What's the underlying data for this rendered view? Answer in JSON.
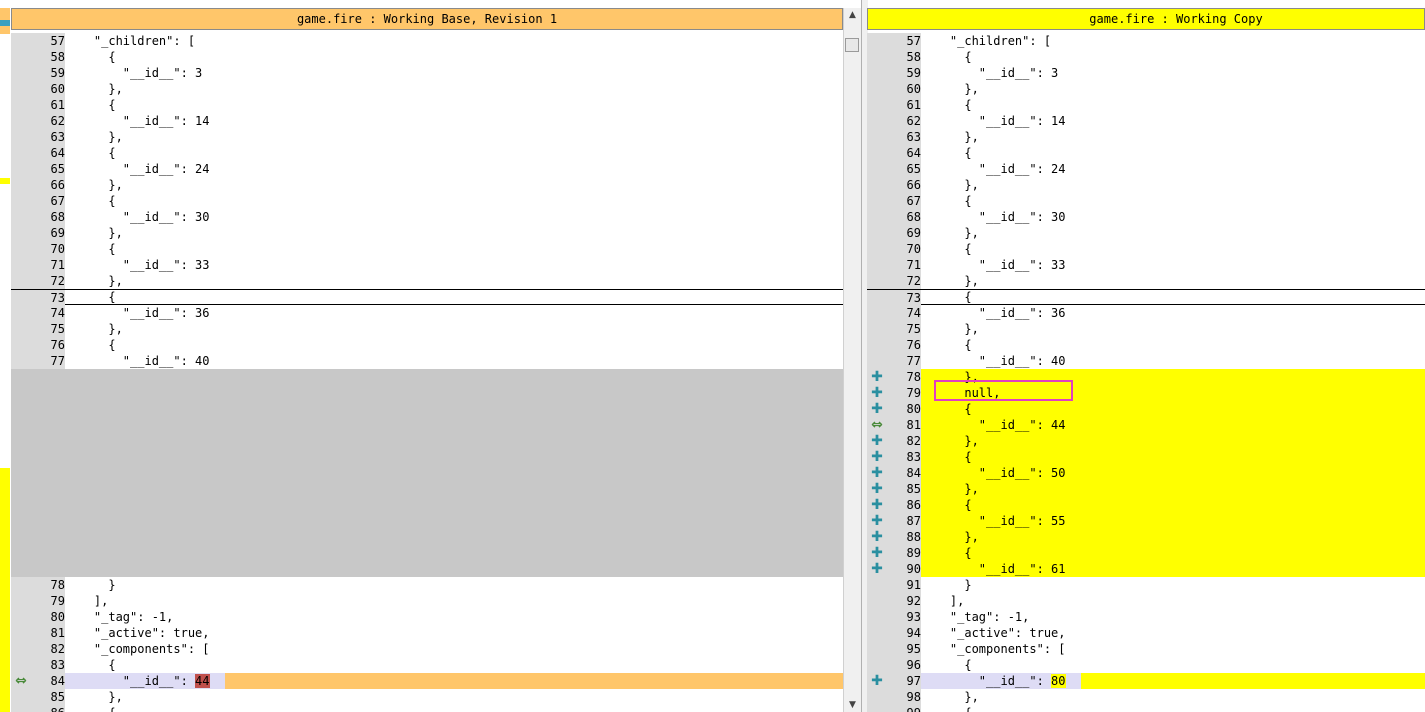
{
  "left_pane": {
    "title": "game.fire : Working Base, Revision 1",
    "rows": [
      {
        "n": "57",
        "code": "    \"_children\": [",
        "state": "normal"
      },
      {
        "n": "58",
        "code": "      {",
        "state": "normal"
      },
      {
        "n": "59",
        "code": "        \"__id__\": 3",
        "state": "normal"
      },
      {
        "n": "60",
        "code": "      },",
        "state": "normal"
      },
      {
        "n": "61",
        "code": "      {",
        "state": "normal"
      },
      {
        "n": "62",
        "code": "        \"__id__\": 14",
        "state": "normal"
      },
      {
        "n": "63",
        "code": "      },",
        "state": "normal"
      },
      {
        "n": "64",
        "code": "      {",
        "state": "normal"
      },
      {
        "n": "65",
        "code": "        \"__id__\": 24",
        "state": "normal"
      },
      {
        "n": "66",
        "code": "      },",
        "state": "normal"
      },
      {
        "n": "67",
        "code": "      {",
        "state": "normal"
      },
      {
        "n": "68",
        "code": "        \"__id__\": 30",
        "state": "normal"
      },
      {
        "n": "69",
        "code": "      },",
        "state": "normal"
      },
      {
        "n": "70",
        "code": "      {",
        "state": "normal"
      },
      {
        "n": "71",
        "code": "        \"__id__\": 33",
        "state": "normal"
      },
      {
        "n": "72",
        "code": "      },",
        "state": "normal"
      },
      {
        "n": "73",
        "code": "      {",
        "state": "current"
      },
      {
        "n": "74",
        "code": "        \"__id__\": 36",
        "state": "normal"
      },
      {
        "n": "75",
        "code": "      },",
        "state": "normal"
      },
      {
        "n": "76",
        "code": "      {",
        "state": "normal"
      },
      {
        "n": "77",
        "code": "        \"__id__\": 40",
        "state": "normal"
      },
      {
        "n": "",
        "code": "",
        "state": "gap"
      },
      {
        "n": "",
        "code": "",
        "state": "gap"
      },
      {
        "n": "",
        "code": "",
        "state": "gap"
      },
      {
        "n": "",
        "code": "",
        "state": "gap"
      },
      {
        "n": "",
        "code": "",
        "state": "gap"
      },
      {
        "n": "",
        "code": "",
        "state": "gap"
      },
      {
        "n": "",
        "code": "",
        "state": "gap"
      },
      {
        "n": "",
        "code": "",
        "state": "gap"
      },
      {
        "n": "",
        "code": "",
        "state": "gap"
      },
      {
        "n": "",
        "code": "",
        "state": "gap"
      },
      {
        "n": "",
        "code": "",
        "state": "gap"
      },
      {
        "n": "",
        "code": "",
        "state": "gap"
      },
      {
        "n": "",
        "code": "",
        "state": "gap"
      },
      {
        "n": "78",
        "code": "      }",
        "state": "normal"
      },
      {
        "n": "79",
        "code": "    ],",
        "state": "normal"
      },
      {
        "n": "80",
        "code": "    \"_tag\": -1,",
        "state": "normal"
      },
      {
        "n": "81",
        "code": "    \"_active\": true,",
        "state": "normal"
      },
      {
        "n": "82",
        "code": "    \"_components\": [",
        "state": "normal"
      },
      {
        "n": "83",
        "code": "      {",
        "state": "normal"
      },
      {
        "n": "84",
        "code": "        \"__id__\": ",
        "value": "44",
        "state": "conflict",
        "mark": "⇔"
      },
      {
        "n": "85",
        "code": "      },",
        "state": "normal"
      },
      {
        "n": "86",
        "code": "      {",
        "state": "normal"
      }
    ]
  },
  "right_pane": {
    "title": "game.fire : Working Copy",
    "rows": [
      {
        "n": "57",
        "code": "    \"_children\": [",
        "state": "normal"
      },
      {
        "n": "58",
        "code": "      {",
        "state": "normal"
      },
      {
        "n": "59",
        "code": "        \"__id__\": 3",
        "state": "normal"
      },
      {
        "n": "60",
        "code": "      },",
        "state": "normal"
      },
      {
        "n": "61",
        "code": "      {",
        "state": "normal"
      },
      {
        "n": "62",
        "code": "        \"__id__\": 14",
        "state": "normal"
      },
      {
        "n": "63",
        "code": "      },",
        "state": "normal"
      },
      {
        "n": "64",
        "code": "      {",
        "state": "normal"
      },
      {
        "n": "65",
        "code": "        \"__id__\": 24",
        "state": "normal"
      },
      {
        "n": "66",
        "code": "      },",
        "state": "normal"
      },
      {
        "n": "67",
        "code": "      {",
        "state": "normal"
      },
      {
        "n": "68",
        "code": "        \"__id__\": 30",
        "state": "normal"
      },
      {
        "n": "69",
        "code": "      },",
        "state": "normal"
      },
      {
        "n": "70",
        "code": "      {",
        "state": "normal"
      },
      {
        "n": "71",
        "code": "        \"__id__\": 33",
        "state": "normal"
      },
      {
        "n": "72",
        "code": "      },",
        "state": "normal"
      },
      {
        "n": "73",
        "code": "      {",
        "state": "current"
      },
      {
        "n": "74",
        "code": "        \"__id__\": 36",
        "state": "normal"
      },
      {
        "n": "75",
        "code": "      },",
        "state": "normal"
      },
      {
        "n": "76",
        "code": "      {",
        "state": "normal"
      },
      {
        "n": "77",
        "code": "        \"__id__\": 40",
        "state": "normal"
      },
      {
        "n": "78",
        "code": "      },",
        "state": "added",
        "mark": "✚"
      },
      {
        "n": "79",
        "code": "      null,",
        "state": "added",
        "mark": "✚"
      },
      {
        "n": "80",
        "code": "      {",
        "state": "added",
        "mark": "✚"
      },
      {
        "n": "81",
        "code": "        \"__id__\": 44",
        "state": "added",
        "mark": "⇔"
      },
      {
        "n": "82",
        "code": "      },",
        "state": "added",
        "mark": "✚"
      },
      {
        "n": "83",
        "code": "      {",
        "state": "added",
        "mark": "✚"
      },
      {
        "n": "84",
        "code": "        \"__id__\": 50",
        "state": "added",
        "mark": "✚"
      },
      {
        "n": "85",
        "code": "      },",
        "state": "added",
        "mark": "✚"
      },
      {
        "n": "86",
        "code": "      {",
        "state": "added",
        "mark": "✚"
      },
      {
        "n": "87",
        "code": "        \"__id__\": 55",
        "state": "added",
        "mark": "✚"
      },
      {
        "n": "88",
        "code": "      },",
        "state": "added",
        "mark": "✚"
      },
      {
        "n": "89",
        "code": "      {",
        "state": "added",
        "mark": "✚"
      },
      {
        "n": "90",
        "code": "        \"__id__\": 61",
        "state": "added",
        "mark": "✚"
      },
      {
        "n": "91",
        "code": "      }",
        "state": "normal"
      },
      {
        "n": "92",
        "code": "    ],",
        "state": "normal"
      },
      {
        "n": "93",
        "code": "    \"_tag\": -1,",
        "state": "normal"
      },
      {
        "n": "94",
        "code": "    \"_active\": true,",
        "state": "normal"
      },
      {
        "n": "95",
        "code": "    \"_components\": [",
        "state": "normal"
      },
      {
        "n": "96",
        "code": "      {",
        "state": "normal"
      },
      {
        "n": "97",
        "code": "        \"__id__\": ",
        "value": "80",
        "state": "conflict",
        "mark": "✚"
      },
      {
        "n": "98",
        "code": "      },",
        "state": "normal"
      },
      {
        "n": "99",
        "code": "      {",
        "state": "normal"
      }
    ]
  },
  "colors": {
    "left_title_bg": "#ffc66a",
    "right_title_bg": "#ffff00",
    "added_line_bg": "#ffff00",
    "gap_bg": "#c8c8c8",
    "gutter_bg": "#dcdcdc",
    "conflict_line_bg": "#dedcf5",
    "conflict_value_left_bg": "#c0504d",
    "highlight_box": "#e040c0",
    "plus_icon": "#2a8fa0",
    "swap_icon": "#4a8a3a"
  },
  "scrollbar": {
    "up_icon": "scroll-up-arrow",
    "down_icon": "scroll-down-arrow"
  }
}
